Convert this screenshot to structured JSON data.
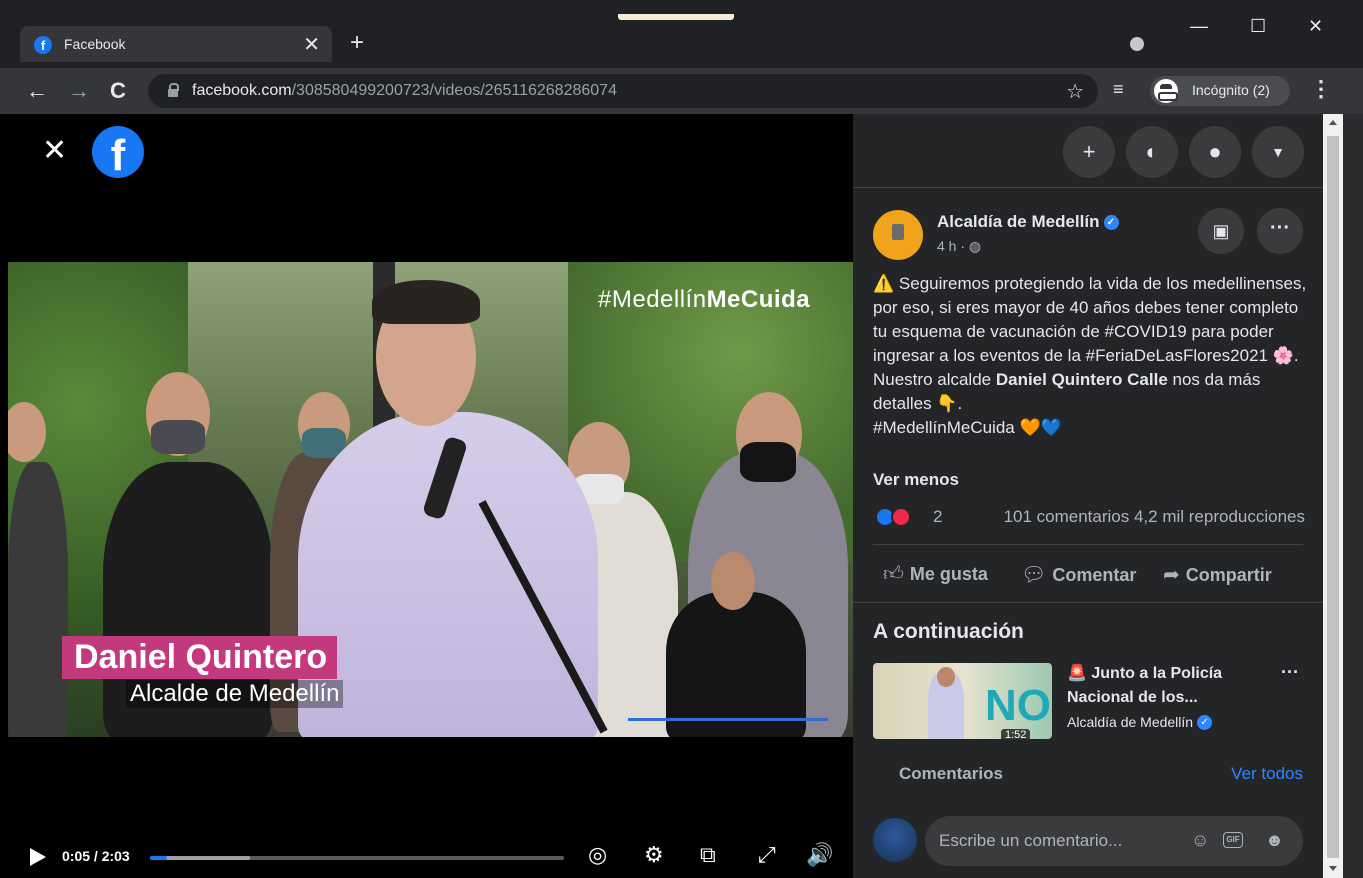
{
  "browser": {
    "tab_title": "Facebook",
    "tab_close": "✕",
    "new_tab": "+",
    "url_host": "facebook.com",
    "url_path": "/308580499200723/videos/265116268286074",
    "incognito_label": "Incógnito (2)",
    "window_controls": {
      "minimize": "—",
      "maximize": "☐",
      "close": "✕"
    },
    "nav": {
      "back": "←",
      "forward": "→",
      "reload": "C"
    }
  },
  "viewer": {
    "close": "✕",
    "logo": "f",
    "overlay_hashtag_plain": "#Medellín",
    "overlay_hashtag_bold": "MeCuida",
    "lower_third_name": "Daniel Quintero",
    "lower_third_role": "Alcalde de Medellín",
    "time": "0:05 / 2:03",
    "progress_fraction": 0.041
  },
  "top_actions": [
    "create-icon",
    "messenger-icon",
    "notifications-icon",
    "account-menu-icon"
  ],
  "post": {
    "page_name": "Alcaldía de Medellín",
    "meta": "4 h · ",
    "text_line1": "Seguiremos protegiendo la vida de los medellinenses, por eso, si eres mayor de 40 años debes tener completo tu esquema de vacunación de #COVID19 para poder ingresar a los eventos de la #FeriaDeLasFlores2021",
    "text_line2_prefix": "Nuestro alcalde ",
    "text_line2_bold": "Daniel Quintero Calle",
    "text_line2_suffix": " nos da más detalles",
    "text_line3": "#MedellínMeCuida",
    "see_less": "Ver menos",
    "reaction_count": "2",
    "stats": "101 comentarios  4,2 mil reproducciones",
    "actions": {
      "like": "Me gusta",
      "comment": "Comentar",
      "share": "Compartir"
    }
  },
  "up_next": {
    "title": "A continuación",
    "video_title": "Junto a la Policía Nacional de los...",
    "video_page": "Alcaldía de Medellín",
    "thumb_text": "NO",
    "thumb_duration": "1:52"
  },
  "comments": {
    "label": "Comentarios",
    "see_all": "Ver todos",
    "placeholder": "Escribe un comentario...",
    "gif_label": "GIF"
  },
  "colors": {
    "facebook_blue": "#1877f2",
    "brand_magenta": "#c2397d",
    "panel_bg": "#242526"
  }
}
